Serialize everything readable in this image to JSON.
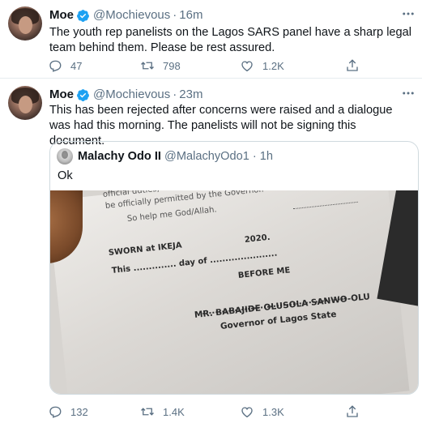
{
  "tweets": [
    {
      "name": "Moe",
      "handle": "@Mochievous",
      "separator": "·",
      "time": "16m",
      "text": "The youth rep panelists on the Lagos SARS panel have a sharp legal team behind them. Please be rest assured.",
      "replies": "47",
      "retweets": "798",
      "likes": "1.2K"
    },
    {
      "name": "Moe",
      "handle": "@Mochievous",
      "separator": "·",
      "time": "23m",
      "text": "This has been rejected after concerns were raised and a dialogue was had this morning. The panelists will not be signing this document.",
      "replies": "132",
      "retweets": "1.4K",
      "likes": "1.3K",
      "quote": {
        "name": "Malachy Odo II",
        "handle": "@MalachyOdo1",
        "separator": "·",
        "time": "1h",
        "text": "Ok",
        "photo_text": {
          "line1": "official duties,",
          "line2": "be officially permitted by the Governor.",
          "line3": "So help me God/Allah.",
          "line4": "SWORN at IKEJA",
          "line5": "This .............. day of ......................",
          "line6": "2020.",
          "line7": "BEFORE ME",
          "line8": "MR. BABAJIDE OLUSOLA SANWO-OLU",
          "line9": "Governor of Lagos State"
        }
      }
    }
  ],
  "colors": {
    "accent": "#1da1f2",
    "secondary_text": "#5b7083",
    "border": "#e6ecf0"
  }
}
